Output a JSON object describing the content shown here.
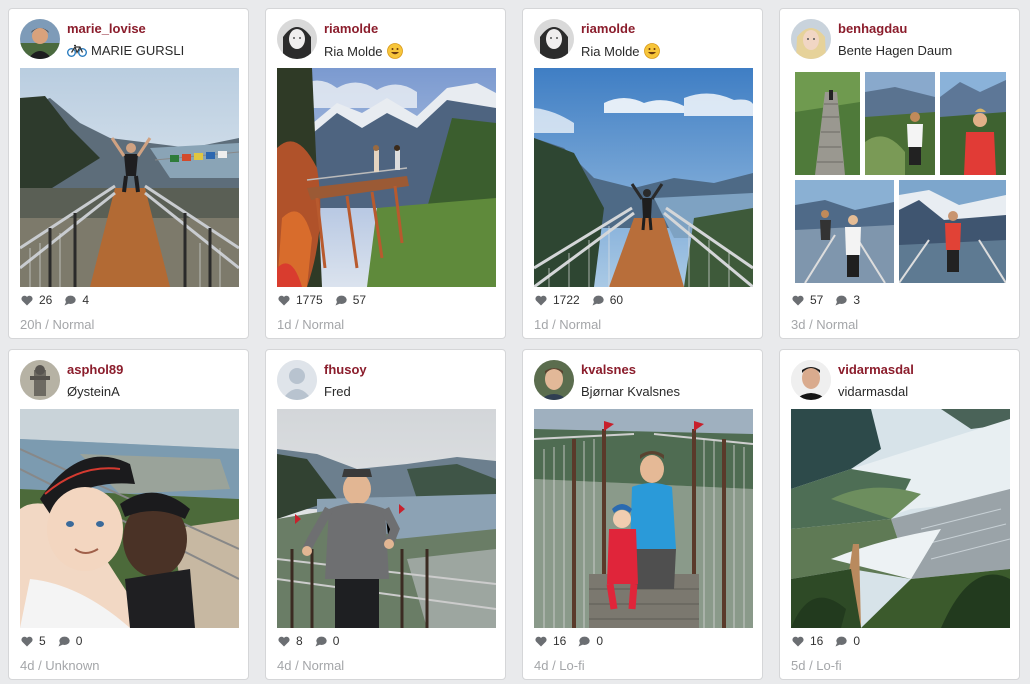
{
  "posts": [
    {
      "username": "marie_lovise",
      "fullname": "MARIE GURSLI",
      "fullname_icon": "bicycle-icon",
      "likes": "26",
      "comments": "4",
      "age": "20h",
      "filter": "Normal",
      "meta": "20h / Normal"
    },
    {
      "username": "riamolde",
      "fullname": "Ria Molde",
      "fullname_icon": "smiley-emoji-icon",
      "likes": "1775",
      "comments": "57",
      "age": "1d",
      "filter": "Normal",
      "meta": "1d / Normal"
    },
    {
      "username": "riamolde",
      "fullname": "Ria Molde",
      "fullname_icon": "smiley-emoji-icon",
      "likes": "1722",
      "comments": "60",
      "age": "1d",
      "filter": "Normal",
      "meta": "1d / Normal"
    },
    {
      "username": "benhagdau",
      "fullname": "Bente Hagen Daum",
      "fullname_icon": "",
      "likes": "57",
      "comments": "3",
      "age": "3d",
      "filter": "Normal",
      "meta": "3d / Normal"
    },
    {
      "username": "asphol89",
      "fullname": "ØysteinA",
      "fullname_icon": "",
      "likes": "5",
      "comments": "0",
      "age": "4d",
      "filter": "Unknown",
      "meta": "4d / Unknown"
    },
    {
      "username": "fhusoy",
      "fullname": "Fred",
      "fullname_icon": "",
      "likes": "8",
      "comments": "0",
      "age": "4d",
      "filter": "Normal",
      "meta": "4d / Normal"
    },
    {
      "username": "kvalsnes",
      "fullname": "Bjørnar Kvalsnes",
      "fullname_icon": "",
      "likes": "16",
      "comments": "0",
      "age": "4d",
      "filter": "Lo-fi",
      "meta": "4d / Lo-fi"
    },
    {
      "username": "vidarmasdal",
      "fullname": "vidarmasdal",
      "fullname_icon": "",
      "likes": "16",
      "comments": "0",
      "age": "5d",
      "filter": "Lo-fi",
      "meta": "5d / Lo-fi"
    }
  ],
  "colors": {
    "background": "#e9eaec",
    "card": "#ffffff",
    "username": "#8b1d2c",
    "meta": "#a4a6a9",
    "stats_icon": "#6b6e72"
  }
}
